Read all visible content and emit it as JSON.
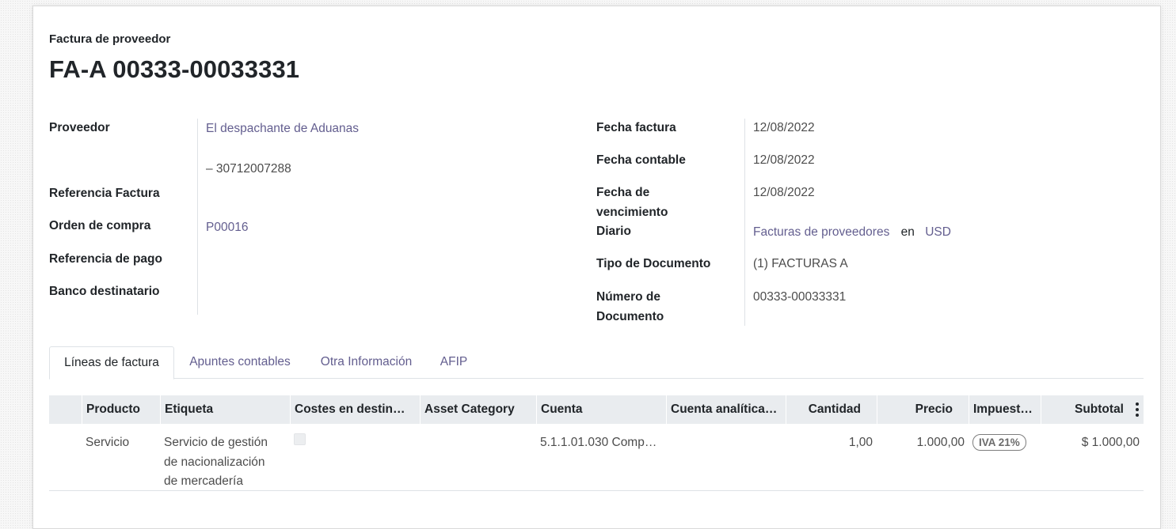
{
  "header": {
    "subtitle": "Factura de proveedor",
    "title": "FA-A 00333-00033331"
  },
  "left_fields": {
    "proveedor_label": "Proveedor",
    "proveedor_value": "El despachante de Aduanas",
    "proveedor_vat": "– 30712007288",
    "ref_factura_label": "Referencia Factura",
    "orden_compra_label": "Orden de compra",
    "orden_compra_value": "P00016",
    "ref_pago_label": "Referencia de pago",
    "banco_label": "Banco destinatario"
  },
  "right_fields": {
    "fecha_factura_label": "Fecha factura",
    "fecha_factura_value": "12/08/2022",
    "fecha_contable_label": "Fecha contable",
    "fecha_contable_value": "12/08/2022",
    "fecha_venc_label_1": "Fecha de",
    "fecha_venc_label_2": "vencimiento",
    "fecha_venc_value": "12/08/2022",
    "diario_label": "Diario",
    "diario_value": "Facturas de proveedores",
    "diario_en": "en",
    "diario_currency": "USD",
    "tipo_doc_label": "Tipo de Documento",
    "tipo_doc_value": "(1) FACTURAS A",
    "num_doc_label_1": "Número de",
    "num_doc_label_2": "Documento",
    "num_doc_value": "00333-00033331"
  },
  "tabs": [
    {
      "label": "Líneas de factura",
      "active": true
    },
    {
      "label": "Apuntes contables",
      "active": false
    },
    {
      "label": "Otra Información",
      "active": false
    },
    {
      "label": "AFIP",
      "active": false
    }
  ],
  "table": {
    "columns": [
      "Producto",
      "Etiqueta",
      "Costes en destin…",
      "Asset Category",
      "Cuenta",
      "Cuenta analítica…",
      "Cantidad",
      "Precio",
      "Impuest…",
      "Subtotal"
    ],
    "rows": [
      {
        "producto": "Servicio",
        "etiqueta_1": "Servicio de gestión",
        "etiqueta_2": "de nacionalización",
        "etiqueta_3": "de mercadería",
        "cuenta": "5.1.1.01.030 Comp…",
        "cantidad": "1,00",
        "precio": "1.000,00",
        "impuesto": "IVA 21%",
        "subtotal": "$ 1.000,00"
      }
    ]
  },
  "colors": {
    "link": "#635e8f",
    "header_bg": "#e9ecef"
  }
}
